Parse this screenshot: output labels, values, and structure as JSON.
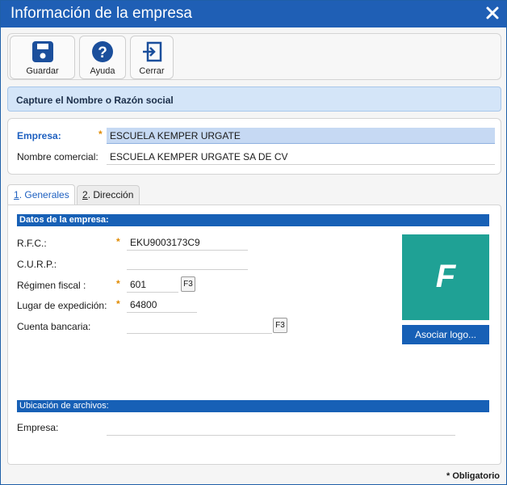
{
  "window": {
    "title": "Información de la empresa"
  },
  "toolbar": {
    "save_label": "Guardar",
    "help_label": "Ayuda",
    "close_label": "Cerrar"
  },
  "banner": {
    "text": "Capture el Nombre o Razón social"
  },
  "company": {
    "empresa_label": "Empresa:",
    "empresa_value": "ESCUELA KEMPER URGATE",
    "nombre_comercial_label": "Nombre comercial:",
    "nombre_comercial_value": "ESCUELA KEMPER URGATE SA DE CV"
  },
  "tabs": [
    {
      "key": "1",
      "label": ". Generales"
    },
    {
      "key": "2",
      "label": ". Dirección"
    }
  ],
  "generales": {
    "section_title": "Datos de la empresa:",
    "rfc_label": "R.F.C.:",
    "rfc_value": "EKU9003173C9",
    "curp_label": "C.U.R.P.:",
    "curp_value": "",
    "regimen_label": "Régimen fiscal :",
    "regimen_value": "601",
    "lugar_label": "Lugar de expedición:",
    "lugar_value": "64800",
    "cuenta_label": "Cuenta bancaria:",
    "cuenta_value": "",
    "f3_label": "F3",
    "logo_letter": "F",
    "logo_button": "Asociar logo...",
    "files_section_title": "Ubicación de archivos:",
    "files_empresa_label": "Empresa:",
    "files_empresa_value": ""
  },
  "footer": {
    "required_note": "* Obligatorio"
  },
  "colors": {
    "accent": "#1760b6",
    "required": "#e08a00",
    "logo_bg": "#1fa195"
  },
  "required_marker": "*"
}
